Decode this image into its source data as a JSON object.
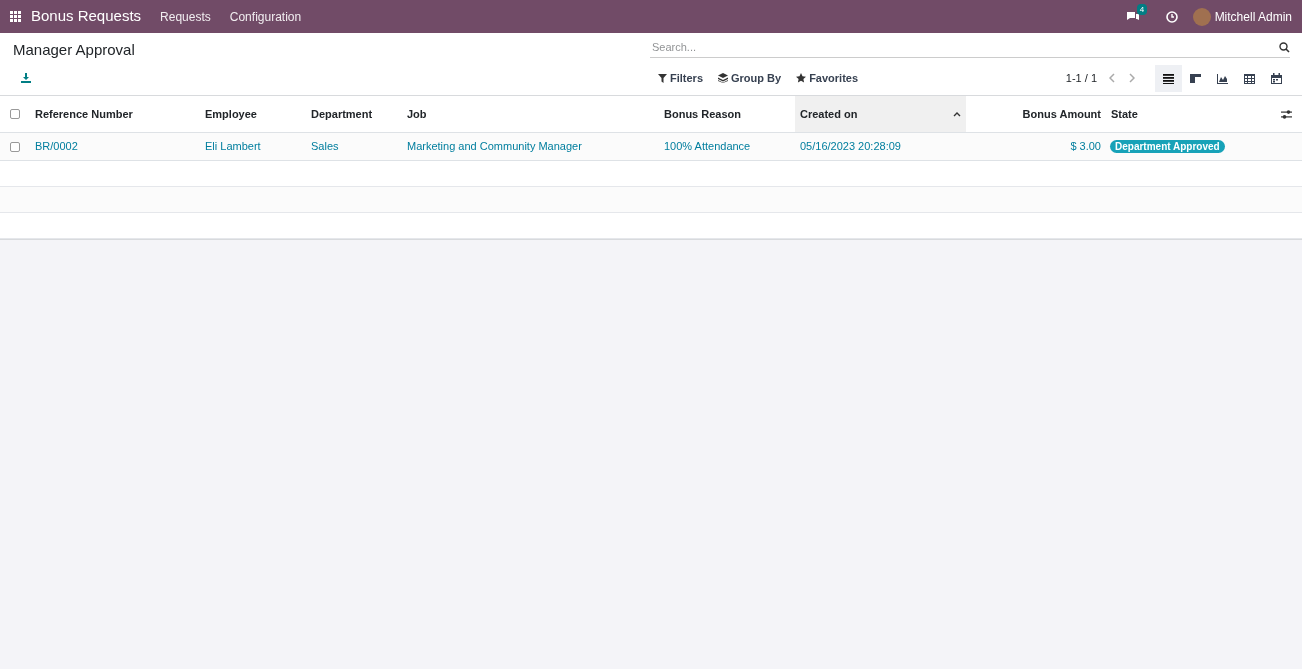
{
  "navbar": {
    "app_title": "Bonus Requests",
    "menus": [
      "Requests",
      "Configuration"
    ],
    "messages_count": "4",
    "user": "Mitchell Admin"
  },
  "control_panel": {
    "breadcrumb": "Manager Approval",
    "search": {
      "placeholder": "Search..."
    },
    "filters": [
      "Filters",
      "Group By",
      "Favorites"
    ],
    "pager": "1-1 / 1",
    "views": [
      {
        "kind": "list",
        "selected": true
      },
      {
        "kind": "kanban",
        "selected": false
      },
      {
        "kind": "graph",
        "selected": false
      },
      {
        "kind": "pivot",
        "selected": false
      },
      {
        "kind": "calendar",
        "selected": false
      }
    ]
  },
  "table": {
    "columns": [
      {
        "label": "Reference Number",
        "kind": "text",
        "sorted": false
      },
      {
        "label": "Employee",
        "kind": "text",
        "sorted": false
      },
      {
        "label": "Department",
        "kind": "text",
        "sorted": false
      },
      {
        "label": "Job",
        "kind": "text",
        "sorted": false
      },
      {
        "label": "Bonus Reason",
        "kind": "text",
        "sorted": false
      },
      {
        "label": "Created on",
        "kind": "text",
        "sorted": true
      },
      {
        "label": "Bonus Amount",
        "kind": "money",
        "sorted": false
      },
      {
        "label": "State",
        "kind": "badge",
        "sorted": false
      }
    ],
    "rows": [
      {
        "checked": false,
        "cells": [
          "BR/0002",
          "Eli Lambert",
          "Sales",
          "Marketing and Community Manager",
          "100% Attendance",
          "05/16/2023 20:28:09",
          "$ 3.00",
          "Department Approved"
        ]
      }
    ],
    "select_all_checked": false
  }
}
